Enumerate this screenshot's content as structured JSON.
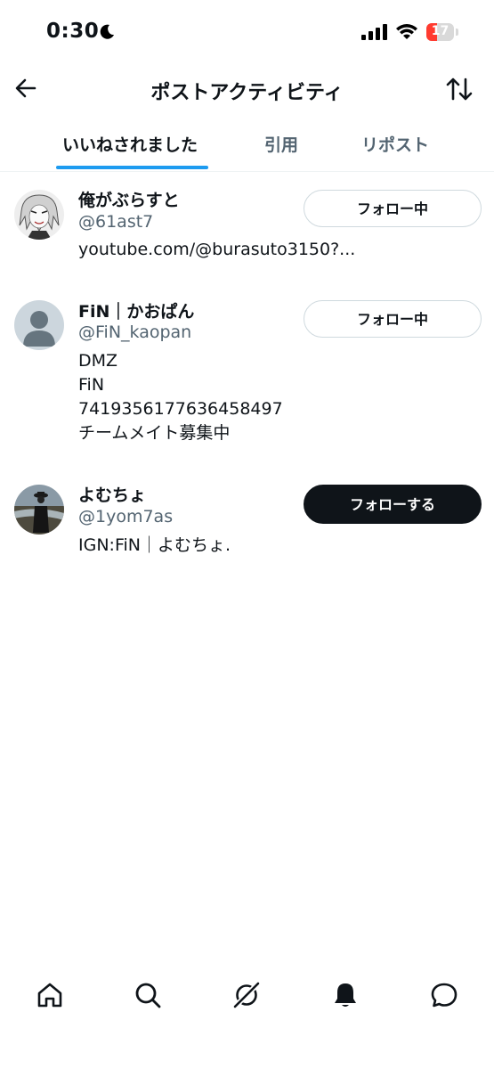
{
  "status_bar": {
    "time": "0:30",
    "battery": "17"
  },
  "header": {
    "title": "ポストアクティビティ",
    "back_icon": "arrow-left-icon",
    "sort_icon": "sort-arrows-icon"
  },
  "tabs": [
    {
      "label": "いいねされました",
      "active": true
    },
    {
      "label": "引用",
      "active": false
    },
    {
      "label": "リポスト",
      "active": false
    }
  ],
  "users": [
    {
      "name": "俺がぶらすと",
      "handle": "@61ast7",
      "bio": [
        "youtube.com/@burasuto3150?..."
      ],
      "button": "フォロー中",
      "following": true
    },
    {
      "name": "FiN｜かおぱん",
      "handle": "@FiN_kaopan",
      "bio": [
        "DMZ",
        "FiN",
        "741935617763645849​7",
        "チームメイト募集中"
      ],
      "button": "フォロー中",
      "following": true
    },
    {
      "name": "よむちょ",
      "handle": "@1yom7as",
      "bio": [
        "IGN:FiN｜よむちょ."
      ],
      "button": "フォローする",
      "following": false
    }
  ],
  "bottom_nav": [
    "home-icon",
    "search-icon",
    "grok-icon",
    "notifications-bell-icon",
    "messages-icon"
  ],
  "colors": {
    "accent": "#1d9bf0",
    "text": "#0f1419",
    "secondary": "#536471",
    "battery_low": "#ff3b30"
  }
}
